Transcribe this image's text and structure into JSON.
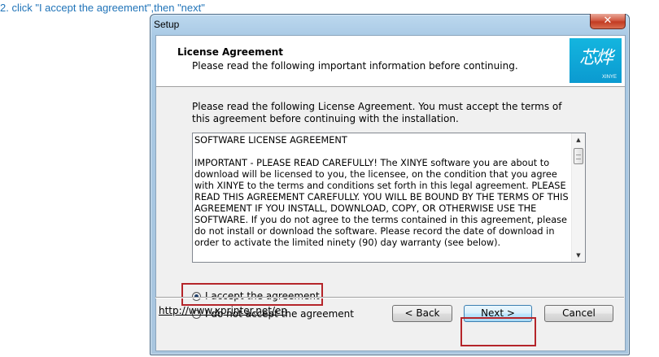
{
  "caption": "2. click \"I accept the agreement\",then \"next\"",
  "window": {
    "title": "Setup",
    "close_label": "✕"
  },
  "header": {
    "title": "License Agreement",
    "subtitle": "Please read the following important information before continuing.",
    "logo_glyphs": "芯烨",
    "logo_small": "XINYE"
  },
  "intro": "Please read the following License Agreement. You must accept the terms of this agreement before continuing with the installation.",
  "license": {
    "text": "SOFTWARE LICENSE AGREEMENT\n\nIMPORTANT - PLEASE READ CAREFULLY!  The XINYE software you are about to download will be licensed to you, the licensee, on the condition that you agree with XINYE to the terms and conditions set forth in this legal agreement.  PLEASE READ THIS AGREEMENT CAREFULLY.  YOU WILL BE BOUND BY THE TERMS OF THIS AGREEMENT IF YOU INSTALL, DOWNLOAD, COPY, OR OTHERWISE USE THE SOFTWARE. If you do not agree to the terms contained in this agreement, please do not install or download the software.  Please record the date of download in order to activate the limited ninety (90) day warranty (see below)."
  },
  "options": {
    "accept_label": "I accept the agreement",
    "decline_label": "I do not accept the agreement",
    "selected": "accept"
  },
  "footer": {
    "link": "http://www.xprinter.net/en",
    "back_label": "< Back",
    "next_label": "Next >",
    "cancel_label": "Cancel"
  },
  "colors": {
    "caption": "#1f73b8",
    "highlight": "#b5252a",
    "logo_bg": "#0ea6d8"
  }
}
